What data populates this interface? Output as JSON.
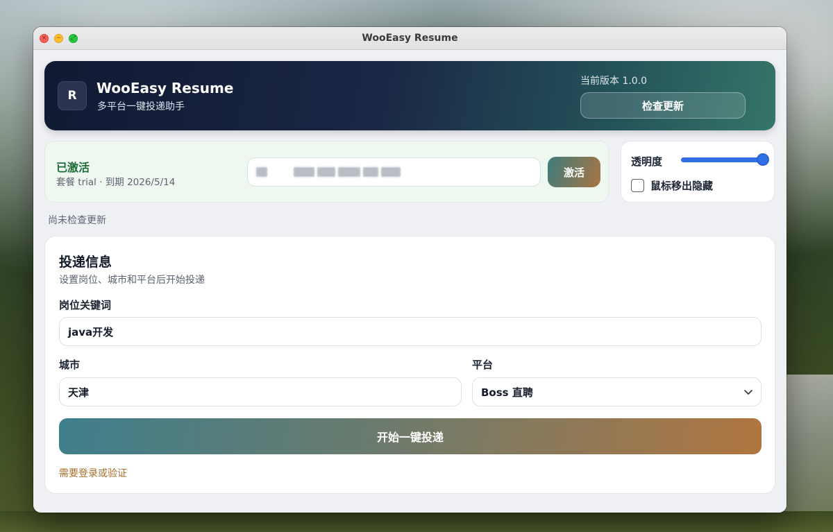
{
  "window": {
    "title": "WooEasy Resume"
  },
  "header": {
    "logo_letter": "R",
    "app_name": "WooEasy Resume",
    "subtitle": "多平台一键投递助手",
    "version_text": "当前版本 1.0.0",
    "check_update_label": "检查更新"
  },
  "license": {
    "status": "已激活",
    "plan": "套餐 trial · 到期 2026/5/14",
    "activate_label": "激活"
  },
  "opacity": {
    "label": "透明度",
    "value_fraction": 1.0,
    "hide_on_mouse_out_label": "鼠标移出隐藏",
    "hide_on_mouse_out_checked": false
  },
  "update_status": "尚未检查更新",
  "form": {
    "title": "投递信息",
    "subtitle": "设置岗位、城市和平台后开始投递",
    "keyword_label": "岗位关键词",
    "keyword_value": "java开发",
    "city_label": "城市",
    "city_value": "天津",
    "platform_label": "平台",
    "platform_value": "Boss 直聘",
    "submit_label": "开始一键投递",
    "login_note": "需要登录或验证"
  },
  "colors": {
    "accent_blue": "#2f6ee5",
    "activated_green": "#1f6b35",
    "note_orange": "#a8702a"
  }
}
